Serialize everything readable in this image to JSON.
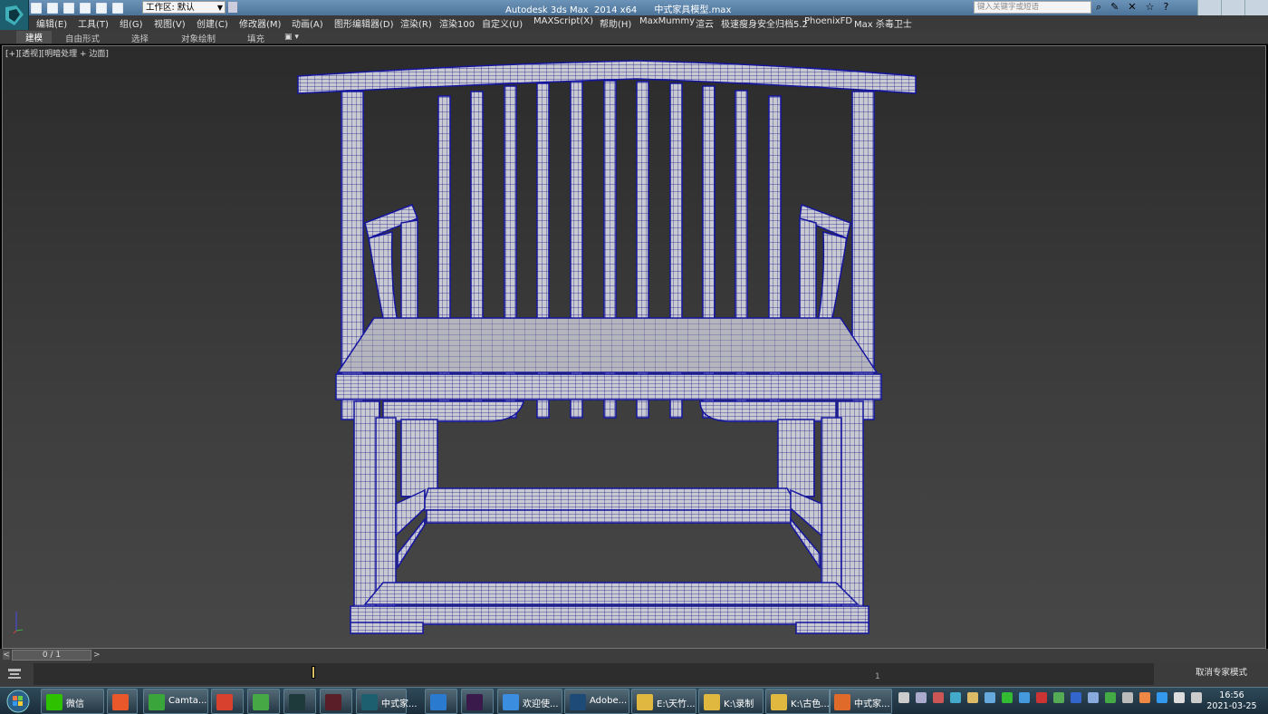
{
  "title": {
    "app": "Autodesk 3ds Max  2014 x64",
    "file": "中式家具模型.max",
    "workspace": "工作区: 默认",
    "help_placeholder": "键入关键字或短语"
  },
  "menu": [
    "编辑(E)",
    "工具(T)",
    "组(G)",
    "视图(V)",
    "创建(C)",
    "修改器(M)",
    "动画(A)",
    "图形编辑器(D)",
    "渲染(R)",
    "渲染100",
    "自定义(U)",
    "MAXScript(X)",
    "帮助(H)",
    "MaxMummy",
    "渲云",
    "极速瘦身安全归档5.2",
    "PhoenixFD",
    "Max 杀毒卫士"
  ],
  "ribbon_tabs": [
    "建模",
    "自由形式",
    "选择",
    "对象绘制",
    "填充"
  ],
  "viewport": {
    "label_plus": "[+]",
    "label_view": "[透视]",
    "label_shading": "[明暗处理 + 边面]"
  },
  "time_slider": {
    "frame": "0 / 1",
    "left": "<",
    "right": ">"
  },
  "trackbar": {
    "end_tick": "1",
    "expert": "取消专家模式"
  },
  "taskbar": [
    {
      "label": "微信",
      "color": "#2dc100"
    },
    {
      "label": "",
      "color": "#e8582a"
    },
    {
      "label": "Camta...",
      "color": "#3aa53a"
    },
    {
      "label": "",
      "color": "#d9412f"
    },
    {
      "label": "",
      "color": "#45a845"
    },
    {
      "label": "",
      "color": "#1e3a3a"
    },
    {
      "label": "",
      "color": "#5a1e28"
    },
    {
      "label": "中式家...",
      "color": "#1d5f6e"
    },
    {
      "label": "",
      "color": "#2a7ad0"
    },
    {
      "label": "",
      "color": "#3a1a4a"
    },
    {
      "label": "欢迎使...",
      "color": "#3b8de0"
    },
    {
      "label": "Adobe...",
      "color": "#1e4a78"
    },
    {
      "label": "E:\\天竹...",
      "color": "#e0b840"
    },
    {
      "label": "K:\\录制",
      "color": "#e0b840"
    },
    {
      "label": "K:\\古色...",
      "color": "#e0b840"
    },
    {
      "label": "中式家...",
      "color": "#e06a2a"
    }
  ],
  "clock": {
    "time": "16:56",
    "date": "2021-03-25"
  }
}
